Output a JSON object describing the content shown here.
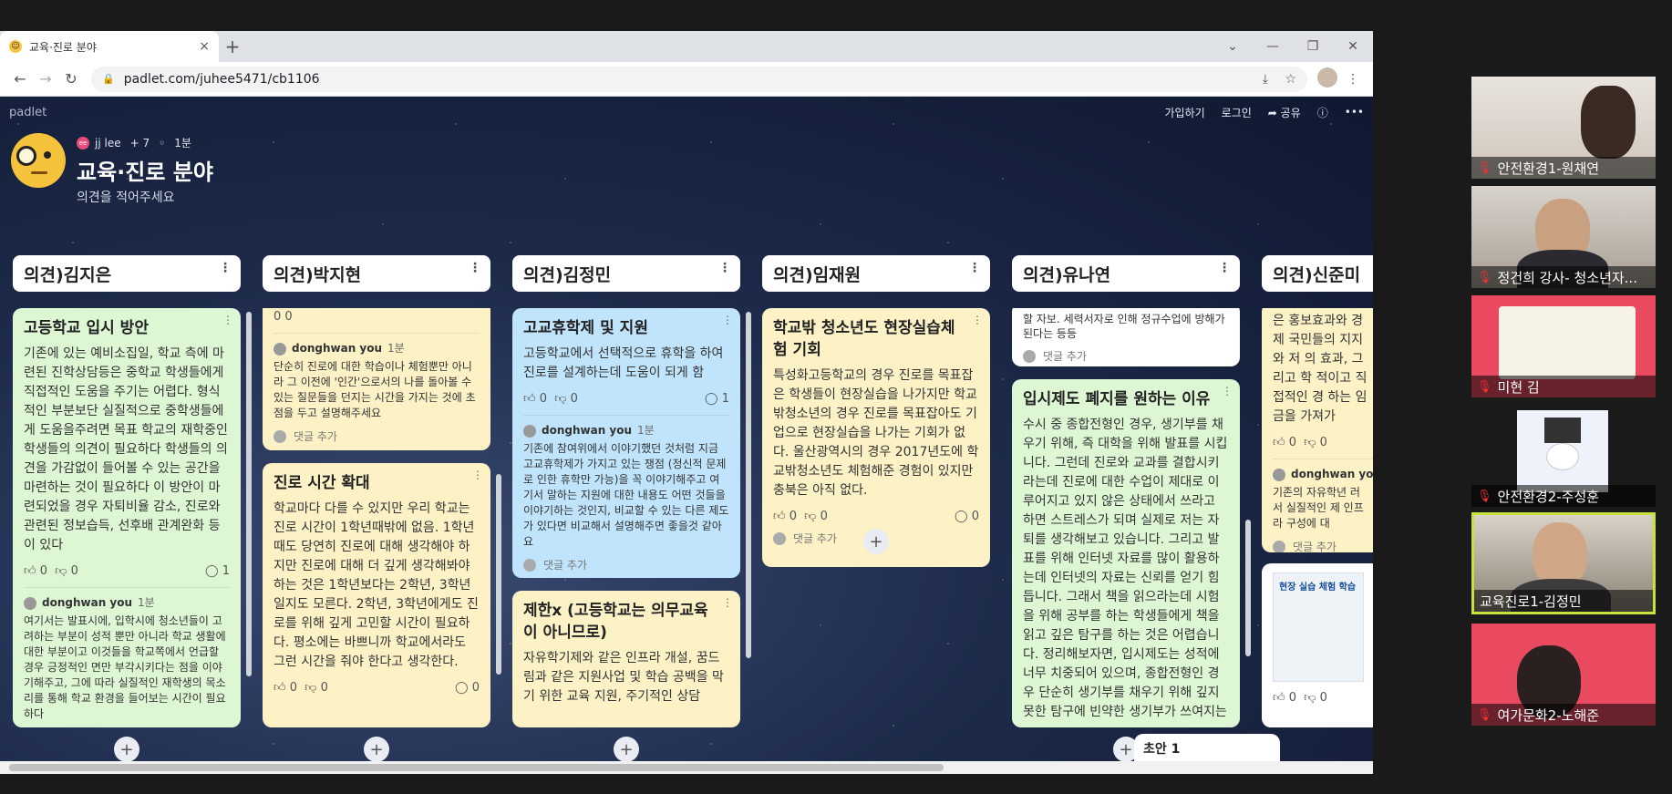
{
  "browser": {
    "tab_title": "교육·진로 분야",
    "tab_close": "×",
    "new_tab": "+",
    "url": "padlet.com/juhee5471/cb1106",
    "win_buttons": [
      "—",
      "❐",
      "✕"
    ]
  },
  "padlet": {
    "brand": "padlet",
    "actions": {
      "signup": "가입하기",
      "login": "로그인",
      "share": "공유"
    },
    "author": "jj lee",
    "collaborators": "+ 7",
    "time": "1분",
    "title": "교육·진로 분야",
    "subtitle": "의견을 적어주세요",
    "draft_label": "초안 1"
  },
  "columns": [
    {
      "header": "의견)김지은",
      "cards": [
        {
          "title": "고등학교 입시 방안",
          "body": "기존에 있는 예비소집일, 학교 측에 마련된 진학상담등은 중학교 학생들에게 직접적인 도움을 주기는 어렵다. 형식적인 부분보단 실질적으로 중학생들에게 도움을주려면 목표 학교의 재학중인 학생들의 의견이 필요하다 학생들의 의견을 가감없이 들어볼 수 있는 공간을 마련하는 것이 필요하다 이 방안이 마련되었을 경우 자퇴비율 감소, 진로와 관련된 정보습득, 선후배 관계완화 등이 있다",
          "likes": "0",
          "dislikes": "0",
          "comments": "1",
          "commenter": "donghwan you",
          "comment_time": "1분",
          "comment": "여기서는 발표시에, 입학시에 청소년들이 고려하는 부분이 성적 뿐만 아니라 학교 생활에 대한 부분이고 이것들을 학교쪽에서 언급할 경우 긍정적인 면만 부각시키다는 점을 이야기해주고, 그에 따라 실질적인 재학생의 목소리를 통해 학교 환경을 들어보는 시간이 필요하다"
        }
      ]
    },
    {
      "header": "의견)박지현",
      "cards": [
        {
          "top_react": "0 0",
          "commenter": "donghwan you",
          "comment_time": "1분",
          "comment": "단순히 진로에 대한 학습이나 체험뿐만 아니라 그 이전에 '인간'으로서의 나를 돌아볼 수 있는 질문들을 던지는 시간을 가지는 것에 초점을 두고 설명해주세요",
          "add_comment": "댓글 추가"
        },
        {
          "title": "진로 시간 확대",
          "body": "학교마다 다를 수 있지만 우리 학교는 진로 시간이 1학년때밖에 없음. 1학년때도 당연히 진로에 대해 생각해야 하지만 진로에 대해 더 깊게 생각해봐야 하는 것은 1학년보다는 2학년, 3학년일지도 모른다. 2학년, 3학년에게도 진로를 위해 깊게 고민할 시간이 필요하다. 평소에는 바쁘니까 학교에서라도 그런 시간을 줘야 한다고 생각한다.",
          "likes": "0",
          "dislikes": "0",
          "comments": "0"
        }
      ]
    },
    {
      "header": "의견)김정민",
      "cards": [
        {
          "title": "고교휴학제 및 지원",
          "body": "고등학교에서 선택적으로 휴학을 하여 진로를 설계하는데 도움이 되게 함",
          "likes": "0",
          "dislikes": "0",
          "comments": "1",
          "commenter": "donghwan you",
          "comment_time": "1분",
          "comment": "기존에 참여위에서 이야기했던 것처럼 지금 고교휴학제가 가지고 있는 쟁점 (정신적 문제로 인한 휴학만 가능)을 꼭 이야기해주고 여기서 말하는 지원에 대한 내용도 어떤 것들을 이야기하는 것인지, 비교할 수 있는 다른 제도가 있다면 비교해서 설명해주면 좋을것 같아요",
          "add_comment": "댓글 추가"
        },
        {
          "title": "제한x (고등학교는 의무교육이 아니므로)",
          "body": "자유학기제와 같은 인프라 개설, 꿈드림과 같은 지원사업 및 학습 공백을 막기 위한 교육 지원, 주기적인 상담"
        }
      ]
    },
    {
      "header": "의견)임재원",
      "cards": [
        {
          "title": "학교밖 청소년도 현장실습체험 기회",
          "body": "특성화고등학교의 경우 진로를 목표잡은 학생들이 현장실습을 나가지만 학교밖청소년의 경우 진로를 목표잡아도 기업으로 현장실습을 나가는 기회가 없다. 울산광역시의 경우 2017년도에 학교밖청소년도 체험해준 경험이 있지만 충북은 아직 없다.",
          "likes": "0",
          "dislikes": "0",
          "comments": "0",
          "add_comment": "댓글 추가"
        }
      ]
    },
    {
      "header": "의견)유나연",
      "cards": [
        {
          "top_text": "할 자보. 세력서자로 인해 정규수업에 방해가 된다는 등등",
          "add_comment": "댓글 추가"
        },
        {
          "title": "입시제도 폐지를 원하는 이유",
          "body": "수시 중 종합전형인 경우, 생기부를 채우기 위해, 즉 대학을 위해 발표를 시킵니다. 그런데 진로와 교과를 결합시키라는데 진로에 대한 수업이 제대로 이루어지고 있지 않은 상태에서 쓰라고 하면 스트레스가 되며 실제로 저는 자퇴를 생각해보고 있습니다. 그리고 발표를 위해 인터넷 자료를 많이 활용하는데 인터넷의 자료는 신뢰를 얻기 힘듭니다. 그래서 책을 읽으라는데 시험을 위해 공부를 하는 학생들에게 책을 읽고 깊은 탐구를 하는 것은 어렵습니다. 정리해보자면, 입시제도는 성적에 너무 치중되어 있으며, 종합전형인 경우 단순히 생기부를 채우기 위해 깊지 못한 탐구에 빈약한 생기부가 쓰여지는"
        }
      ]
    },
    {
      "header": "의견)신준미",
      "cards": [
        {
          "top_text": "은 홍보효과와 경제 국민들의 지지와 저 의 효과, 그리고 학 적이고 직접적인 경 하는 임금을 가져가",
          "likes": "0",
          "dislikes": "0",
          "commenter": "donghwan you",
          "comment": "기존의 자유학년 러서 실질적인 제 인프라 구성에 대",
          "add_comment": "댓글 추가"
        },
        {
          "image_caption": "현장 실습 체험 학습",
          "likes": "0",
          "dislikes": "0"
        }
      ]
    }
  ],
  "participants": [
    {
      "name": "안전환경1-원채연",
      "muted": true
    },
    {
      "name": "정건희 강사- 청소년자...",
      "muted": true
    },
    {
      "name": "미현 김",
      "muted": true
    },
    {
      "name": "안전환경2-주성훈",
      "muted": true
    },
    {
      "name": "교육진로1-김정민",
      "muted": false,
      "active": true
    },
    {
      "name": "여가문화2-노해준",
      "muted": true
    }
  ]
}
